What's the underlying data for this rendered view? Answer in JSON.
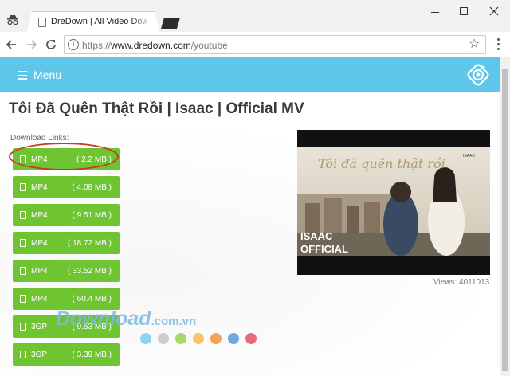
{
  "browser": {
    "tab_title": "DreDown | All Video Dow",
    "url_domain": "www.dredown.com",
    "url_prefix": "https://",
    "url_path": "/youtube"
  },
  "menu": {
    "label": "Menu"
  },
  "video": {
    "title": "Tôi Đã Quên Thật Rồi | Isaac | Official MV",
    "views_label": "Views: 4011013",
    "thumbnail_caption_line1": "ISAAC",
    "thumbnail_caption_line2": "OFFICIAL",
    "thumbnail_script": "Tôi đã quên thật rồi",
    "thumbnail_corner": "ISAAC"
  },
  "downloads": {
    "label": "Download Links:",
    "items": [
      {
        "format": "MP4",
        "size": "( 2.2 MB )"
      },
      {
        "format": "MP4",
        "size": "( 4.08 MB )"
      },
      {
        "format": "MP4",
        "size": "( 9.51 MB )"
      },
      {
        "format": "MP4",
        "size": "( 18.72 MB )"
      },
      {
        "format": "MP4",
        "size": "( 33.52 MB )"
      },
      {
        "format": "MP4",
        "size": "( 60.4 MB )"
      },
      {
        "format": "3GP",
        "size": "( 9.53 MB )"
      },
      {
        "format": "3GP",
        "size": "( 3.39 MB )"
      }
    ]
  },
  "watermark": {
    "text": "Download",
    "domain": ".com.vn"
  },
  "colors": {
    "menu_bar": "#5ec6e8",
    "download_button": "#6fc431",
    "highlight": "#c83a28",
    "dots": [
      "#8fd3f4",
      "#cccccc",
      "#a6d96a",
      "#f7c46c",
      "#f4a259",
      "#6fa8dc",
      "#e66a7a"
    ]
  }
}
